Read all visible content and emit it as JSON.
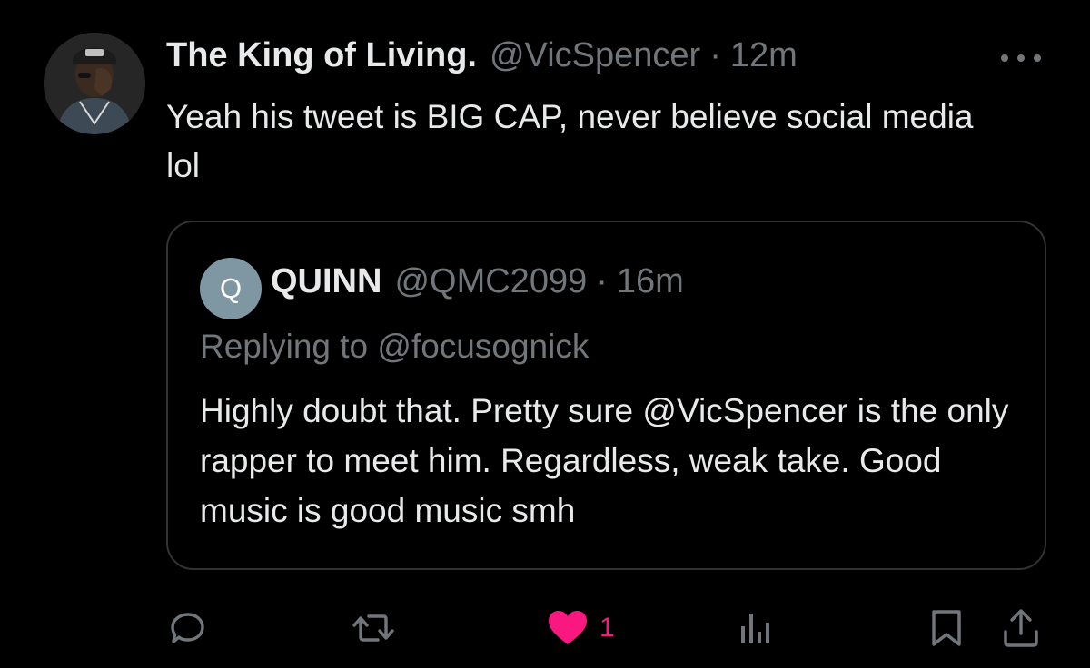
{
  "tweet": {
    "display_name": "The King of Living.",
    "handle": "@VicSpencer",
    "separator": "·",
    "time": "12m",
    "text": "Yeah his tweet is BIG CAP, never believe social media lol"
  },
  "quote": {
    "avatar_initial": "Q",
    "display_name": "QUINN",
    "handle": "@QMC2099",
    "separator": "·",
    "time": "16m",
    "replying_prefix": "Replying to",
    "replying_to": "@focusognick",
    "text": "Highly doubt that. Pretty sure @VicSpencer is the only rapper to meet him. Regardless, weak take. Good music is good music smh"
  },
  "actions": {
    "reply_icon": "reply-icon",
    "retweet_icon": "retweet-icon",
    "like_icon": "heart-filled-icon",
    "like_count": "1",
    "views_icon": "views-icon",
    "bookmark_icon": "bookmark-icon",
    "share_icon": "share-icon"
  },
  "colors": {
    "background": "#000000",
    "text_primary": "#e7e9ea",
    "text_secondary": "#71767b",
    "border": "#2f3336",
    "like_pink": "#f91880",
    "quote_avatar": "#7f96a3"
  }
}
